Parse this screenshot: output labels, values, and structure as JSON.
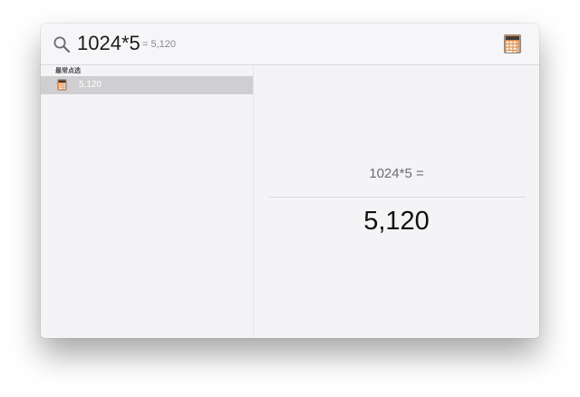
{
  "search": {
    "query": "1024*5",
    "inline_result": "= 5,120",
    "search_icon": "search-icon",
    "app_icon": "calculator-icon"
  },
  "sidebar": {
    "section_header": "最常点选",
    "items": [
      {
        "label": "5,120",
        "icon": "calculator-icon",
        "selected": true
      }
    ]
  },
  "preview": {
    "expression": "1024*5 =",
    "result": "5,120"
  },
  "colors": {
    "selection": "#cfcfd2",
    "window_bg": "#f4f4f6",
    "calculator_orange": "#e8883a"
  }
}
